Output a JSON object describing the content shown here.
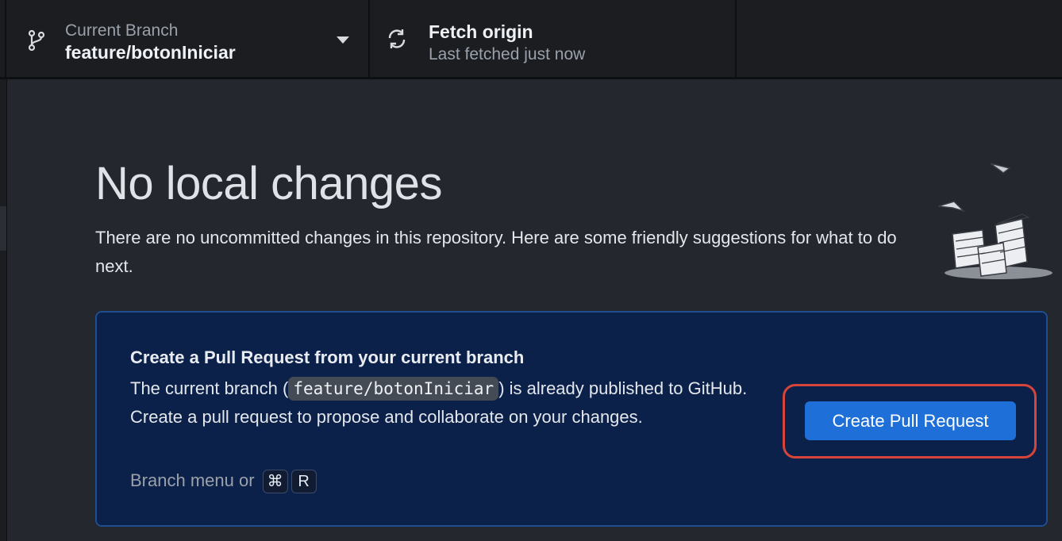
{
  "toolbar": {
    "branch": {
      "label": "Current Branch",
      "value": "feature/botonIniciar"
    },
    "fetch": {
      "title": "Fetch origin",
      "status": "Last fetched just now"
    }
  },
  "main": {
    "heading": "No local changes",
    "description": "There are no uncommitted changes in this repository. Here are some friendly suggestions for what to do next."
  },
  "suggestion": {
    "title": "Create a Pull Request from your current branch",
    "body_before": "The current branch (",
    "branch_code": "feature/botonIniciar",
    "body_after": ") is already published to GitHub. Create a pull request to propose and collaborate on your changes.",
    "shortcut_prefix": "Branch menu or",
    "shortcut_keys": [
      "⌘",
      "R"
    ],
    "button_label": "Create Pull Request"
  },
  "colors": {
    "accent": "#1f6fd9",
    "card_background": "#0c2149",
    "highlight": "#d7443a"
  },
  "icons": {
    "branch": "git-branch-icon",
    "fetch": "sync-icon",
    "dropdown": "caret-down-icon"
  }
}
